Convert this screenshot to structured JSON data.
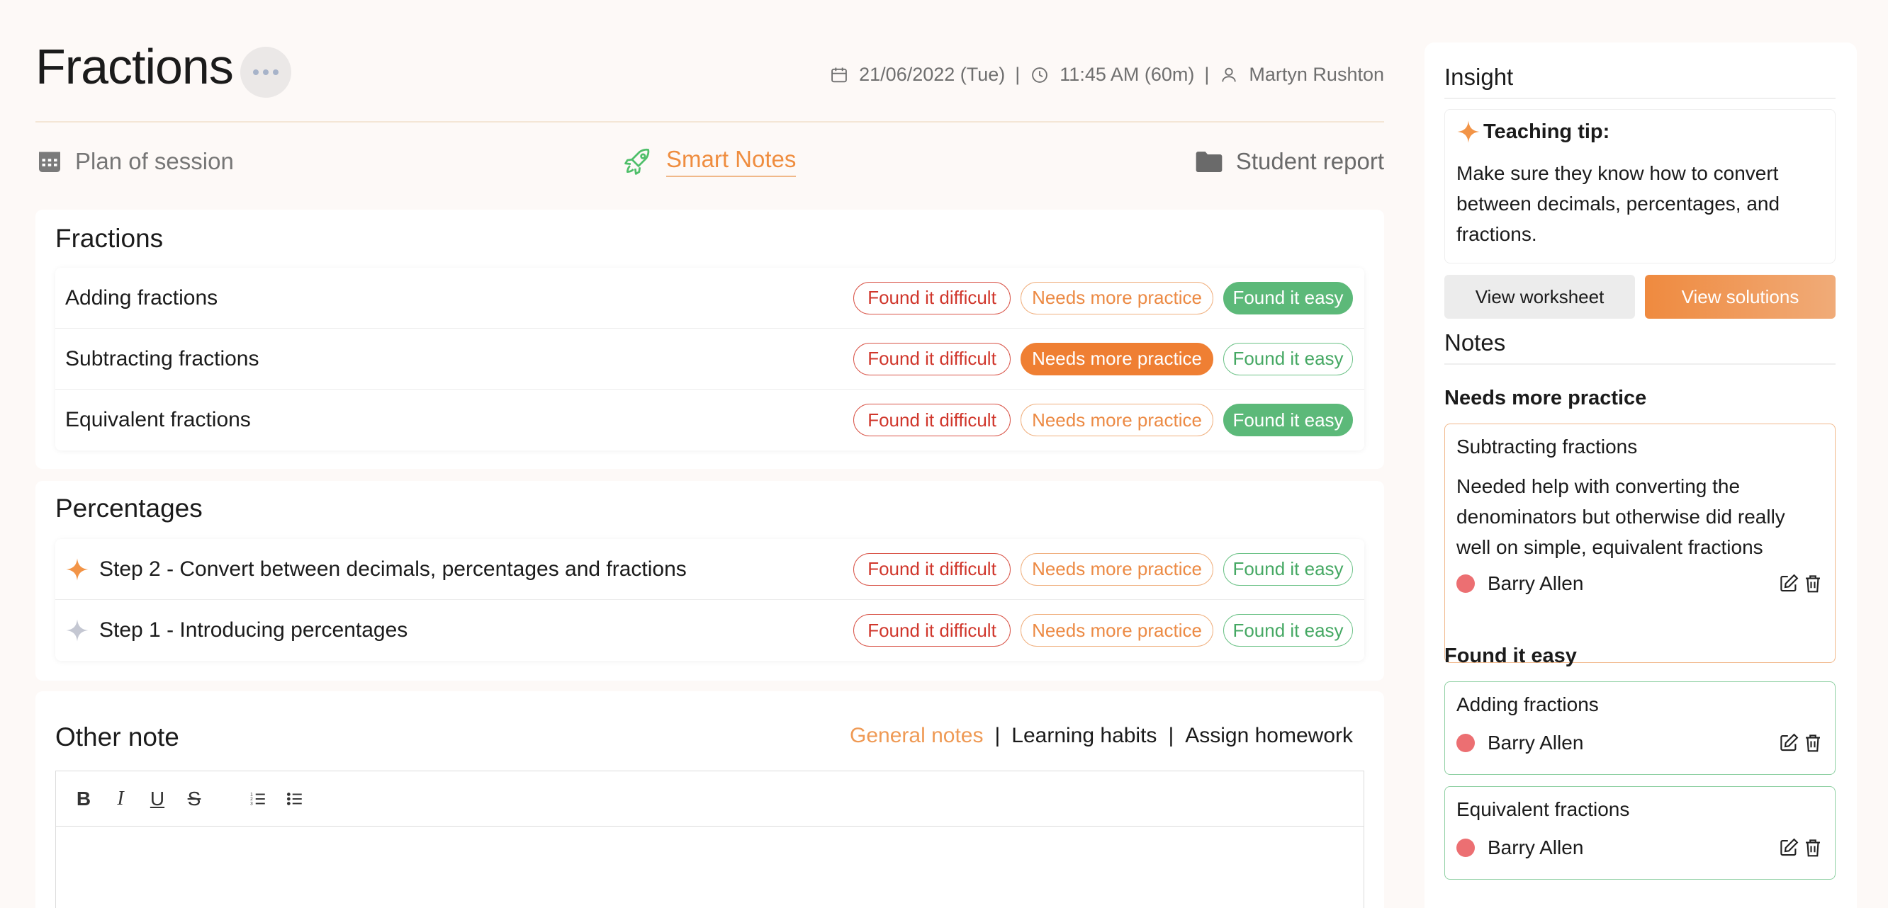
{
  "header": {
    "title": "Fractions",
    "date": "21/06/2022 (Tue)",
    "time": "11:45 AM (60m)",
    "tutor": "Martyn Rushton",
    "separator": "|"
  },
  "tabs": [
    {
      "label": "Plan of session",
      "icon": "calendar-icon"
    },
    {
      "label": "Smart Notes",
      "icon": "rocket-icon",
      "active": true
    },
    {
      "label": "Student report",
      "icon": "folder-icon"
    }
  ],
  "pill_labels": {
    "difficult": "Found it difficult",
    "practice": "Needs more practice",
    "easy": "Found it easy"
  },
  "sections": [
    {
      "title": "Fractions",
      "rows": [
        {
          "label": "Adding fractions",
          "selected": "easy"
        },
        {
          "label": "Subtracting fractions",
          "selected": "practice"
        },
        {
          "label": "Equivalent fractions",
          "selected": "easy"
        }
      ]
    },
    {
      "title": "Percentages",
      "rows": [
        {
          "label": "Step 2 - Convert between decimals, percentages and fractions",
          "selected": "none",
          "icon": "sparkle-icon-orange"
        },
        {
          "label": "Step 1 - Introducing percentages",
          "selected": "none",
          "icon": "sparkle-icon-grey"
        }
      ]
    }
  ],
  "other_note": {
    "title": "Other note",
    "tabs": [
      "General notes",
      "Learning habits",
      "Assign homework"
    ],
    "active_tab": "General notes",
    "toolbar": [
      "B",
      "I",
      "U",
      "S"
    ]
  },
  "sidebar": {
    "insight_title": "Insight",
    "tip_title": "Teaching tip:",
    "tip_text": "Make sure they know how to convert between decimals, percentages, and fractions.",
    "view_worksheet": "View worksheet",
    "view_solutions": "View solutions",
    "notes_title": "Notes",
    "practice_heading": "Needs more practice",
    "easy_heading": "Found it easy",
    "notes": [
      {
        "title": "Subtracting fractions",
        "text": "Needed help with converting the denominators but otherwise did really well on simple, equivalent fractions",
        "student": "Barry Allen",
        "group": "practice"
      },
      {
        "title": "Adding fractions",
        "student": "Barry Allen",
        "group": "easy"
      },
      {
        "title": "Equivalent fractions",
        "student": "Barry Allen",
        "group": "easy"
      }
    ]
  },
  "colors": {
    "accent_orange": "#ef7f33",
    "easy_green": "#5cb979",
    "difficult_red": "#d0362b",
    "student_dot": "#ec6f72"
  }
}
